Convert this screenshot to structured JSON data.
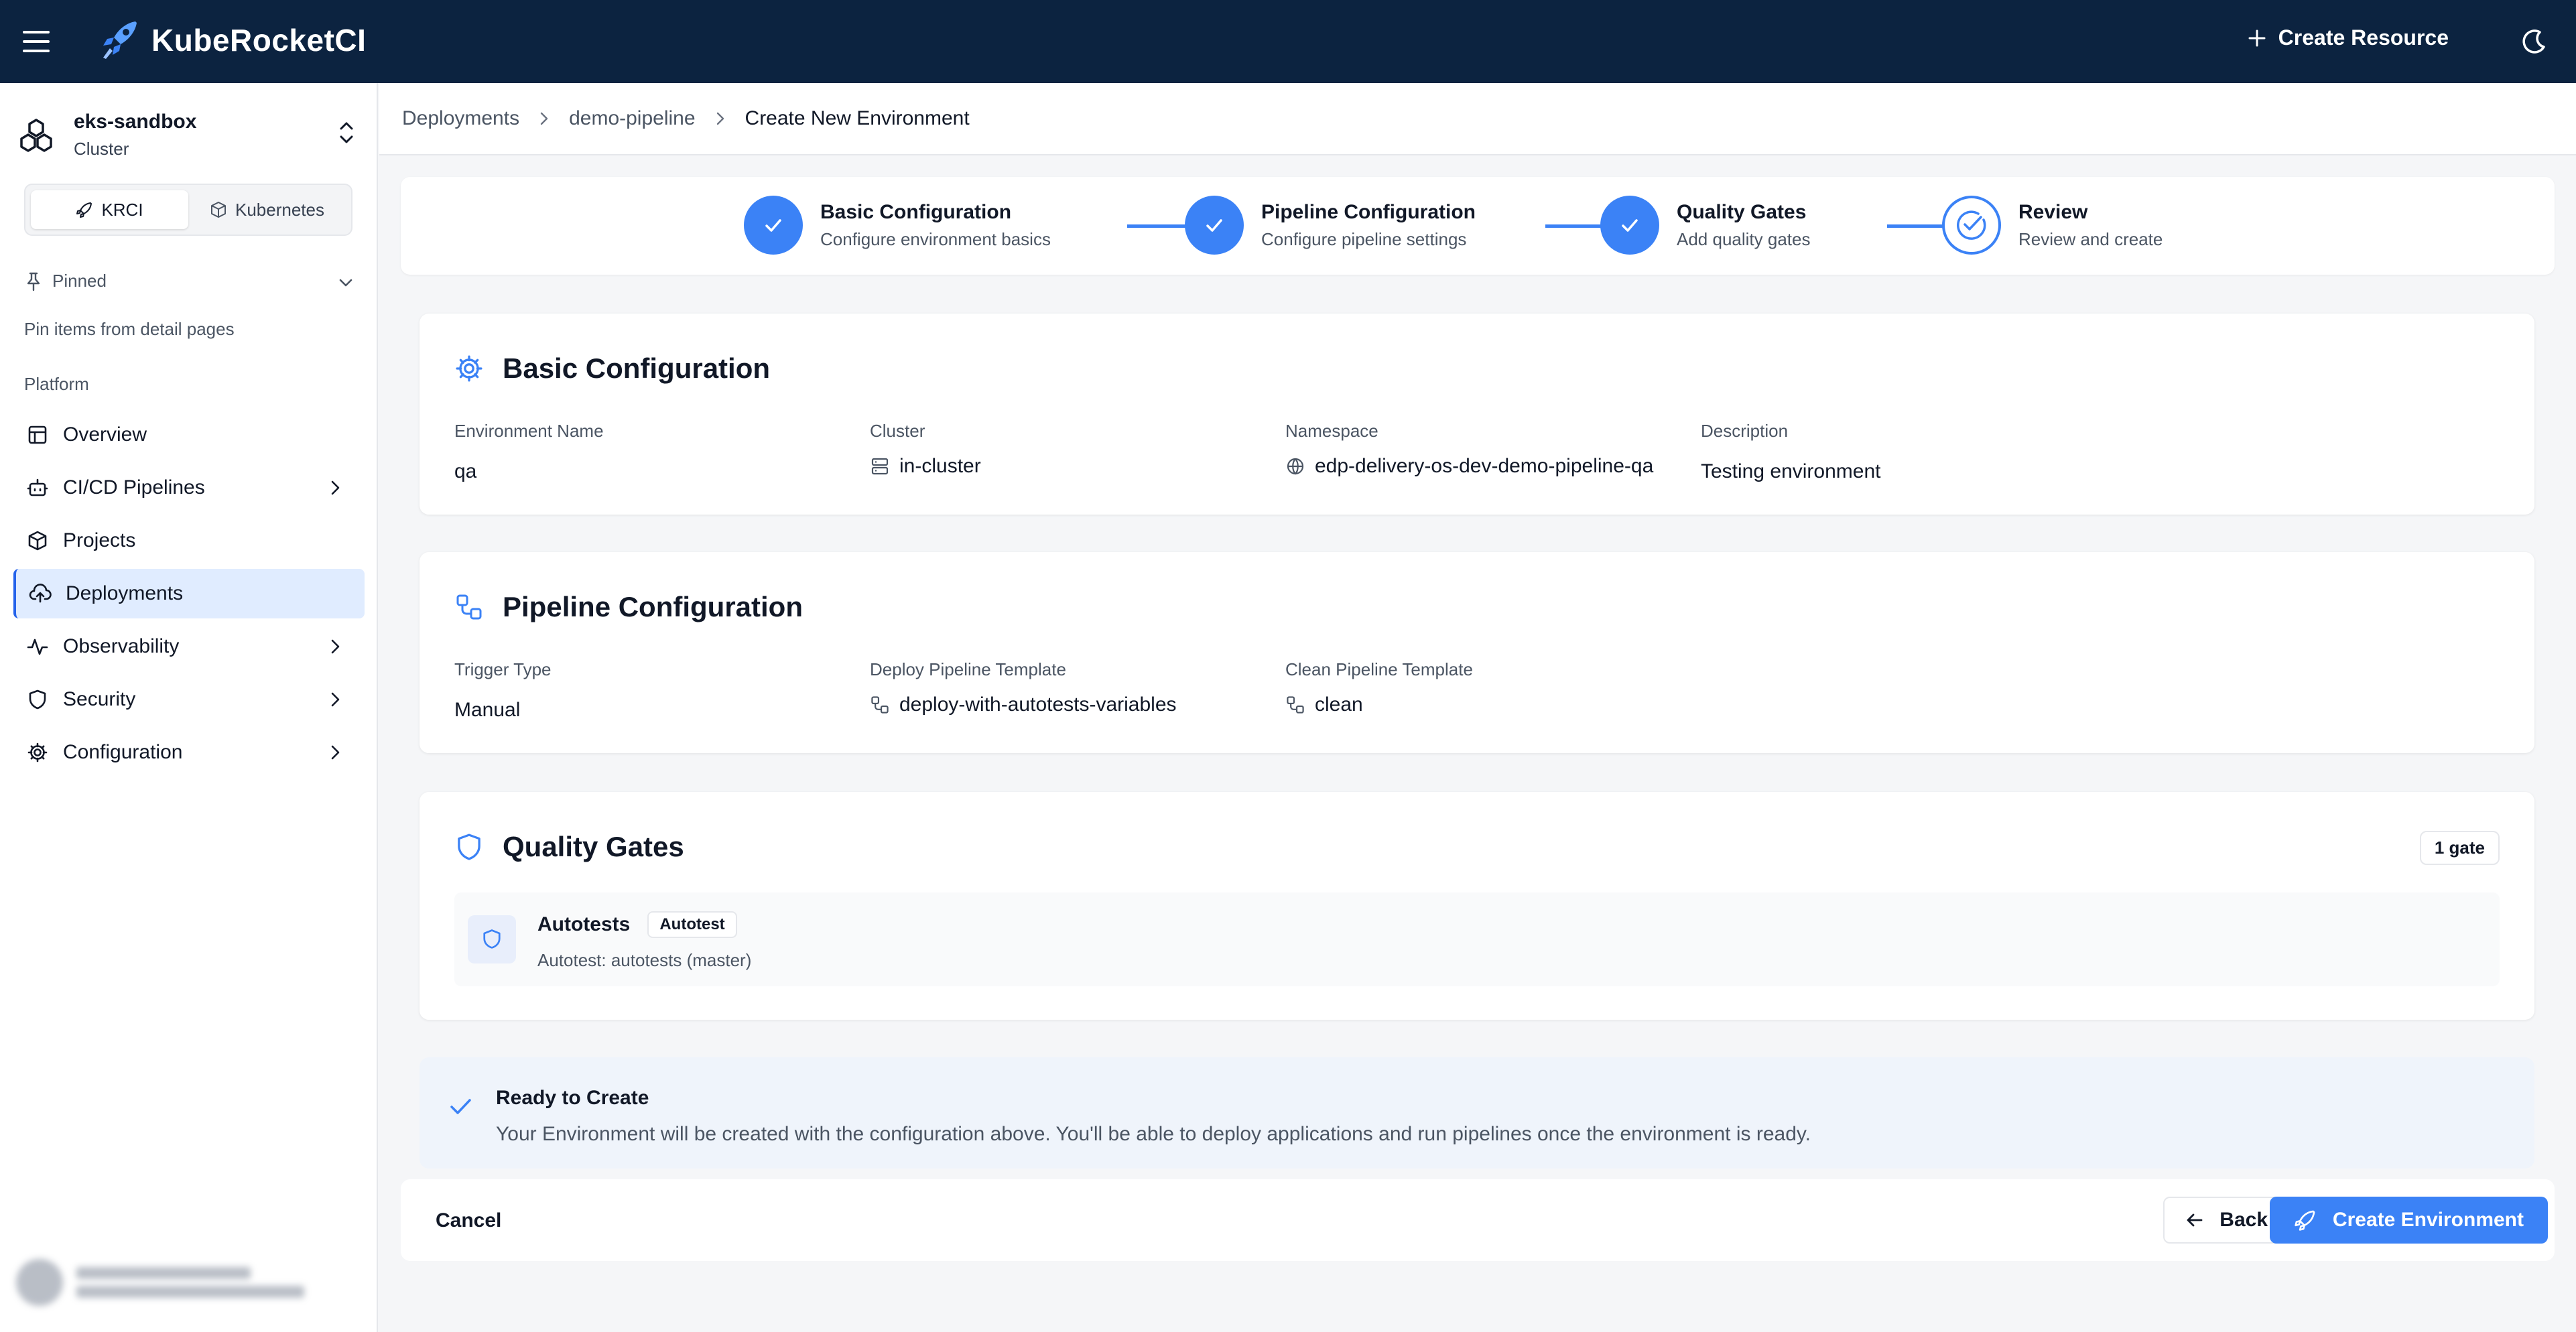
{
  "app": {
    "title": "KubeRocketCI",
    "create_resource_label": "Create Resource",
    "icons": {
      "menu": "menu-icon",
      "logo": "rocket-icon",
      "plus": "plus-icon",
      "theme": "moon-icon"
    }
  },
  "colors": {
    "topbar": "#0c2340",
    "accent": "#3b82f6",
    "active_nav": "#e0ecff"
  },
  "sidebar": {
    "cluster": {
      "name": "eks-sandbox",
      "type": "Cluster"
    },
    "segments": [
      {
        "label": "KRCI",
        "active": true,
        "icon": "rocket-icon"
      },
      {
        "label": "Kubernetes",
        "active": false,
        "icon": "cube-icon"
      }
    ],
    "pinned": {
      "label": "Pinned",
      "hint": "Pin items from detail pages"
    },
    "section_label": "Platform",
    "items": [
      {
        "label": "Overview",
        "icon": "layout-icon",
        "has_children": false,
        "active": false
      },
      {
        "label": "CI/CD Pipelines",
        "icon": "bot-icon",
        "has_children": true,
        "active": false
      },
      {
        "label": "Projects",
        "icon": "box-icon",
        "has_children": false,
        "active": false
      },
      {
        "label": "Deployments",
        "icon": "cloud-upload-icon",
        "has_children": false,
        "active": true
      },
      {
        "label": "Observability",
        "icon": "activity-icon",
        "has_children": true,
        "active": false
      },
      {
        "label": "Security",
        "icon": "shield-icon",
        "has_children": true,
        "active": false
      },
      {
        "label": "Configuration",
        "icon": "gear-icon",
        "has_children": true,
        "active": false
      }
    ]
  },
  "breadcrumb": {
    "items": [
      "Deployments",
      "demo-pipeline",
      "Create New Environment"
    ]
  },
  "stepper": {
    "steps": [
      {
        "title": "Basic Configuration",
        "desc": "Configure environment basics",
        "state": "complete"
      },
      {
        "title": "Pipeline Configuration",
        "desc": "Configure pipeline settings",
        "state": "complete"
      },
      {
        "title": "Quality Gates",
        "desc": "Add quality gates",
        "state": "complete"
      },
      {
        "title": "Review",
        "desc": "Review and create",
        "state": "current"
      }
    ]
  },
  "basic": {
    "title": "Basic Configuration",
    "fields": {
      "env_name": {
        "label": "Environment Name",
        "value": "qa"
      },
      "cluster": {
        "label": "Cluster",
        "value": "in-cluster"
      },
      "namespace": {
        "label": "Namespace",
        "value": "edp-delivery-os-dev-demo-pipeline-qa"
      },
      "description": {
        "label": "Description",
        "value": "Testing environment"
      }
    }
  },
  "pipeline": {
    "title": "Pipeline Configuration",
    "fields": {
      "trigger": {
        "label": "Trigger Type",
        "value": "Manual"
      },
      "deploy": {
        "label": "Deploy Pipeline Template",
        "value": "deploy-with-autotests-variables"
      },
      "clean": {
        "label": "Clean Pipeline Template",
        "value": "clean"
      }
    }
  },
  "gates": {
    "title": "Quality Gates",
    "count_label": "1 gate",
    "items": [
      {
        "name": "Autotests",
        "badge": "Autotest",
        "subtitle": "Autotest: autotests (master)"
      }
    ]
  },
  "ready": {
    "title": "Ready to Create",
    "text": "Your Environment will be created with the configuration above. You'll be able to deploy applications and run pipelines once the environment is ready."
  },
  "actions": {
    "cancel": "Cancel",
    "back": "Back",
    "create": "Create Environment"
  }
}
